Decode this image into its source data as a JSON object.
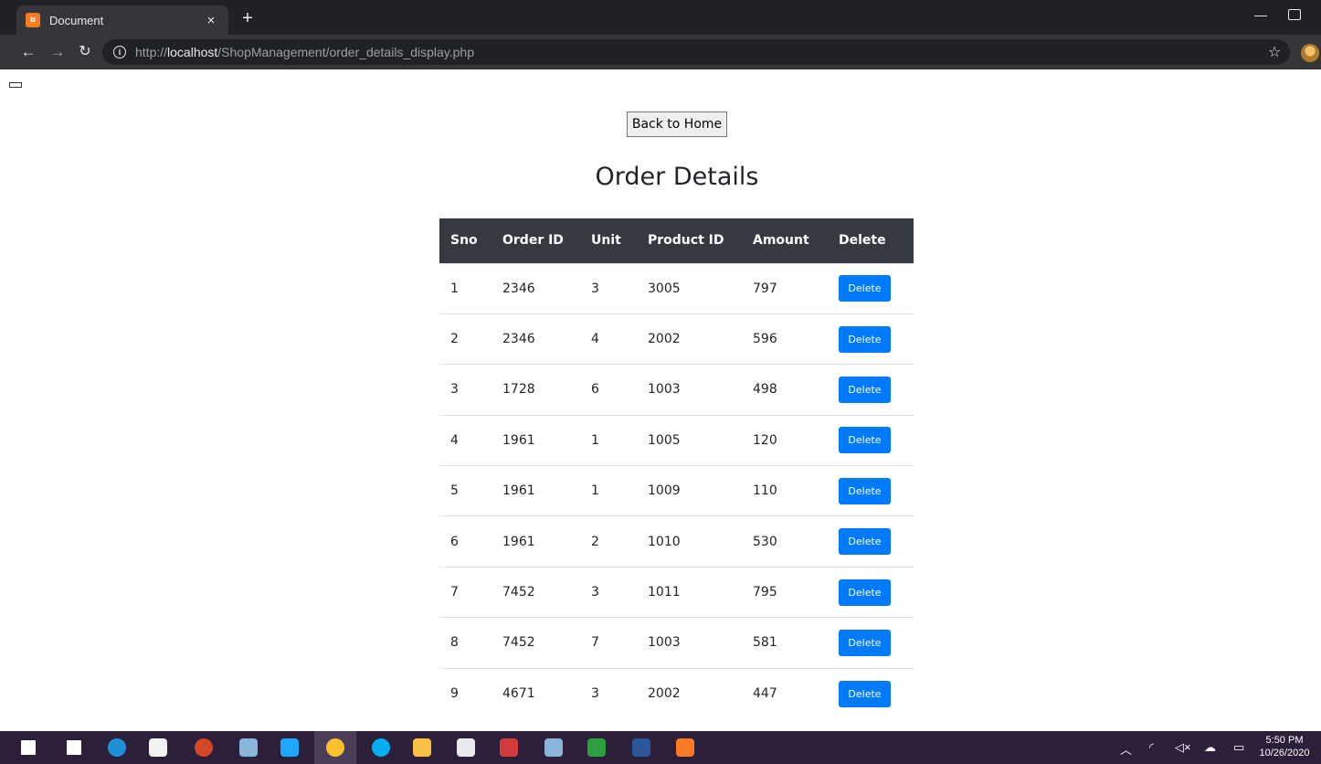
{
  "browser": {
    "tab_title": "Document",
    "tab_close": "×",
    "new_tab": "+",
    "url_prefix": "http://",
    "url_host": "localhost",
    "url_path": "/ShopManagement/order_details_display.php"
  },
  "page": {
    "back_button": "Back to Home",
    "title": "Order Details"
  },
  "table": {
    "headers": [
      "Sno",
      "Order ID",
      "Unit",
      "Product ID",
      "Amount",
      "Delete"
    ],
    "rows": [
      {
        "sno": "1",
        "order_id": "2346",
        "unit": "3",
        "product_id": "3005",
        "amount": "797",
        "action": "Delete"
      },
      {
        "sno": "2",
        "order_id": "2346",
        "unit": "4",
        "product_id": "2002",
        "amount": "596",
        "action": "Delete"
      },
      {
        "sno": "3",
        "order_id": "1728",
        "unit": "6",
        "product_id": "1003",
        "amount": "498",
        "action": "Delete"
      },
      {
        "sno": "4",
        "order_id": "1961",
        "unit": "1",
        "product_id": "1005",
        "amount": "120",
        "action": "Delete"
      },
      {
        "sno": "5",
        "order_id": "1961",
        "unit": "1",
        "product_id": "1009",
        "amount": "110",
        "action": "Delete"
      },
      {
        "sno": "6",
        "order_id": "1961",
        "unit": "2",
        "product_id": "1010",
        "amount": "530",
        "action": "Delete"
      },
      {
        "sno": "7",
        "order_id": "7452",
        "unit": "3",
        "product_id": "1011",
        "amount": "795",
        "action": "Delete"
      },
      {
        "sno": "8",
        "order_id": "7452",
        "unit": "7",
        "product_id": "1003",
        "amount": "581",
        "action": "Delete"
      },
      {
        "sno": "9",
        "order_id": "4671",
        "unit": "3",
        "product_id": "2002",
        "amount": "447",
        "action": "Delete"
      }
    ]
  },
  "taskbar": {
    "time": "5:50 PM",
    "date": "10/26/2020",
    "apps": [
      {
        "name": "windows-start",
        "color": "#ffffff"
      },
      {
        "name": "task-view",
        "color": "#ffffff"
      },
      {
        "name": "edge",
        "color": "#1e90d6"
      },
      {
        "name": "store",
        "color": "#f2f2f2"
      },
      {
        "name": "powerpoint",
        "color": "#d24726"
      },
      {
        "name": "database-app",
        "color": "#8ab4d8"
      },
      {
        "name": "internet-explorer",
        "color": "#1ea7fd"
      },
      {
        "name": "chrome",
        "color": "#fbc02d"
      },
      {
        "name": "skype",
        "color": "#00aff0"
      },
      {
        "name": "file-explorer",
        "color": "#f8c146"
      },
      {
        "name": "virtualbox",
        "color": "#e8eaed"
      },
      {
        "name": "vm-app",
        "color": "#d23b3b"
      },
      {
        "name": "db-app-2",
        "color": "#8ab4d8"
      },
      {
        "name": "green-app",
        "color": "#2ea043"
      },
      {
        "name": "word",
        "color": "#2b579a"
      },
      {
        "name": "xampp",
        "color": "#fb7a24"
      }
    ]
  }
}
